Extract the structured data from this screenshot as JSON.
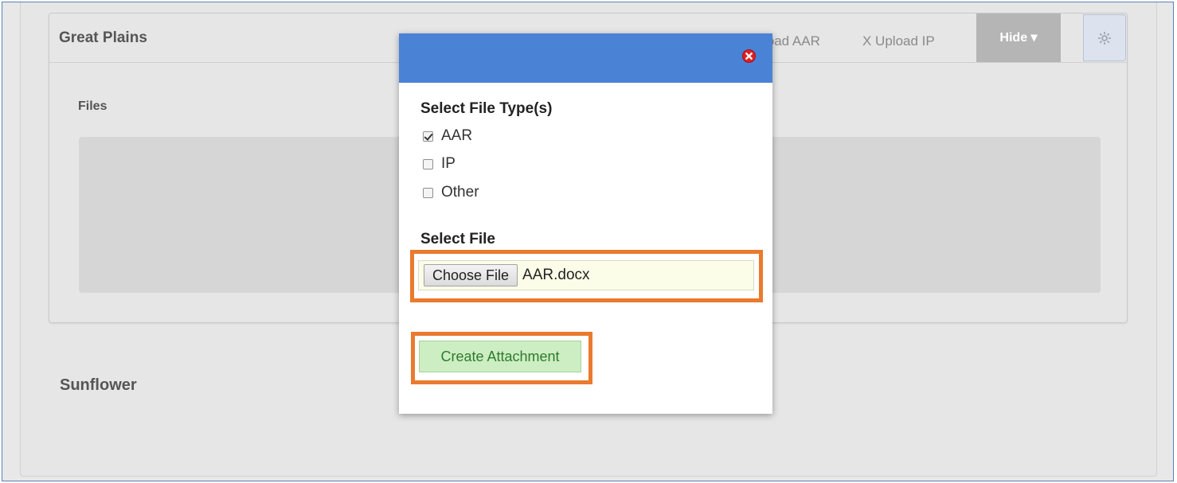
{
  "panel": {
    "title": "Great Plains",
    "upload_aar_link": "load AAR",
    "upload_ip_link": "X Upload IP",
    "hide_button": "Hide ▾",
    "files_label": "Files"
  },
  "sunflower_title": "Sunflower",
  "modal": {
    "file_types_title": "Select File Type(s)",
    "file_types": [
      {
        "label": "AAR",
        "checked": true
      },
      {
        "label": "IP",
        "checked": false
      },
      {
        "label": "Other",
        "checked": false
      }
    ],
    "select_file_title": "Select File",
    "choose_file_button": "Choose File",
    "selected_file": "AAR.docx",
    "create_button": "Create Attachment"
  },
  "colors": {
    "modal_header": "#4a82d6",
    "highlight": "#ea7a2e",
    "create_button_bg": "#cdeec2"
  },
  "icons": {
    "close": "close-icon",
    "settings": "gear-icon"
  }
}
